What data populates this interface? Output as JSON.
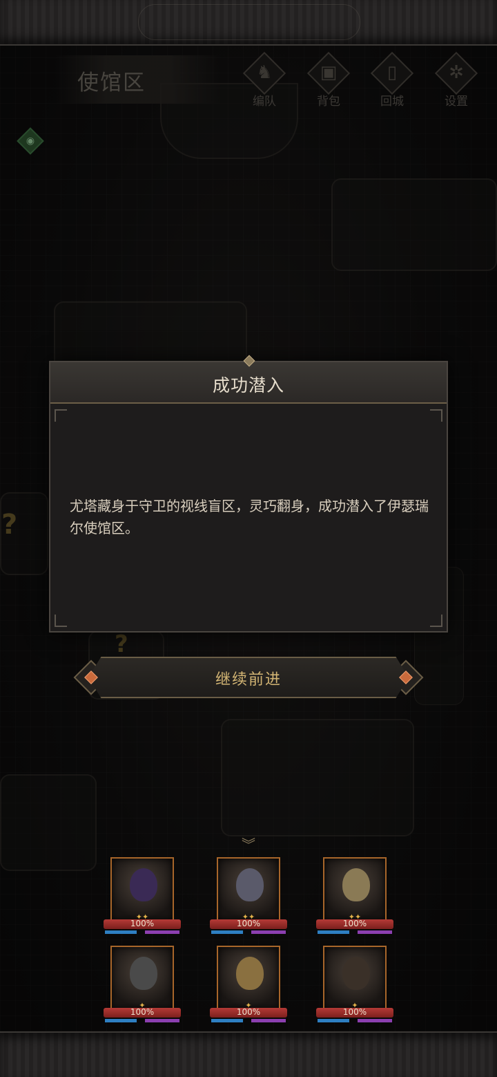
{
  "header": {
    "area_name": "使馆区",
    "buttons": [
      {
        "label": "编队",
        "icon": "helmet-icon",
        "glyph": "♞"
      },
      {
        "label": "背包",
        "icon": "backpack-icon",
        "glyph": "▣"
      },
      {
        "label": "回城",
        "icon": "door-icon",
        "glyph": "▯"
      },
      {
        "label": "设置",
        "icon": "gear-icon",
        "glyph": "✲"
      }
    ]
  },
  "map": {
    "eye_icon": "eye-icon",
    "eye_glyph": "◉",
    "unknown_marker": "?"
  },
  "dialog": {
    "title": "成功潜入",
    "body": "尤塔藏身于守卫的视线盲区，灵巧翻身，成功潜入了伊瑟瑞尔使馆区。"
  },
  "continue_button": {
    "label": "继续前进"
  },
  "party": {
    "collapse_glyph": "︾",
    "heroes": [
      {
        "hp": "100%",
        "stars": "✦✦",
        "hp_fraction": 1.0,
        "tint": "#3a2a55"
      },
      {
        "hp": "100%",
        "stars": "✦✦",
        "hp_fraction": 1.0,
        "tint": "#5a5a6a"
      },
      {
        "hp": "100%",
        "stars": "✦✦",
        "hp_fraction": 1.0,
        "tint": "#8a7a55"
      },
      {
        "hp": "100%",
        "stars": "✦",
        "hp_fraction": 1.0,
        "tint": "#4a4a4a"
      },
      {
        "hp": "100%",
        "stars": "✦",
        "hp_fraction": 1.0,
        "tint": "#8a7040"
      },
      {
        "hp": "100%",
        "stars": "✦",
        "hp_fraction": 1.0,
        "tint": "#3a3028"
      }
    ]
  },
  "colors": {
    "accent_gold": "#d3b574",
    "hp_red": "#b53a36",
    "mana_blue": "#2e7fc2",
    "energy_purple": "#8c3fb0",
    "frame_orange": "#a8662a"
  }
}
